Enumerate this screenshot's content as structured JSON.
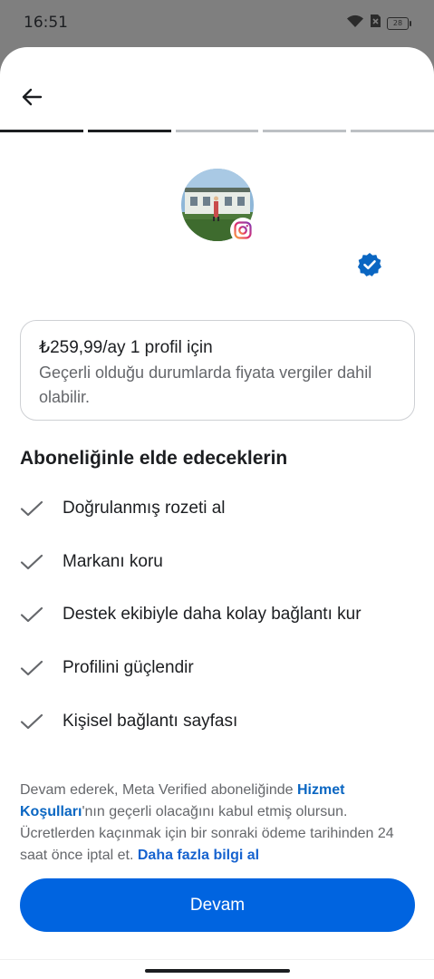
{
  "status_bar": {
    "time": "16:51",
    "battery": "28",
    "icons": [
      "wifi-icon",
      "no-sim-icon",
      "battery-icon"
    ]
  },
  "header": {
    "back_icon": "arrow-left-icon",
    "progress": {
      "total_steps": 5,
      "completed_steps": 2
    }
  },
  "profile": {
    "avatar_icon": "profile-photo",
    "platform_badge": "instagram-icon",
    "verified_icon": "verified-badge-icon"
  },
  "pricing": {
    "price_line": "₺259,99/ay 1 profil için",
    "tax_note": "Geçerli olduğu durumlarda fiyata vergiler dahil olabilir."
  },
  "benefits": {
    "title": "Aboneliğinle elde edeceklerin",
    "items": [
      {
        "label": "Doğrulanmış rozeti al"
      },
      {
        "label": "Markanı koru"
      },
      {
        "label": "Destek ekibiyle daha kolay bağlantı kur"
      },
      {
        "label": "Profilini güçlendir"
      },
      {
        "label": "Kişisel bağlantı sayfası"
      }
    ]
  },
  "legal": {
    "text_1": "Devam ederek, Meta Verified aboneliğinde ",
    "terms_link": "Hizmet Koşulları",
    "text_2": "'nın geçerli olacağını kabul etmiş olursun. Ücretlerden kaçınmak için bir sonraki ödeme tarihinden 24 saat önce iptal et. ",
    "learn_more_link": "Daha fazla bilgi al"
  },
  "cta": {
    "label": "Devam"
  },
  "colors": {
    "primary": "#0064e0",
    "link": "#0a66c2",
    "text": "#1c1e21",
    "secondary_text": "#65676b",
    "verified": "#0a66c2"
  }
}
